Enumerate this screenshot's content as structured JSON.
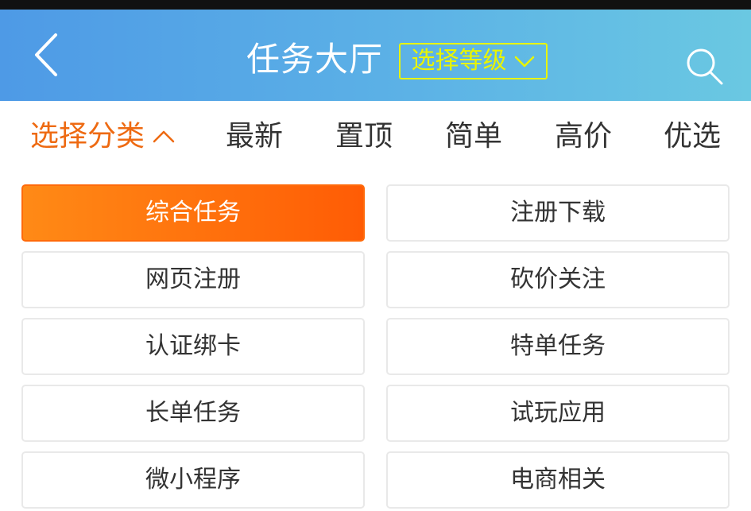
{
  "header": {
    "title": "任务大厅",
    "level_select_label": "选择等级",
    "back_icon": "chevron-left-icon",
    "search_icon": "search-icon"
  },
  "filters": {
    "category": "选择分类",
    "latest": "最新",
    "pinned": "置顶",
    "simple": "简单",
    "high_price": "高价",
    "preferred": "优选"
  },
  "categories": [
    "综合任务",
    "注册下载",
    "网页注册",
    "砍价关注",
    "认证绑卡",
    "特单任务",
    "长单任务",
    "试玩应用",
    "微小程序",
    "电商相关"
  ],
  "colors": {
    "header_start": "#4e9ae6",
    "header_end": "#6ac8e2",
    "level_accent": "#e9f500",
    "active_orange": "#ee6a12",
    "selected_start": "#ff8a16",
    "selected_end": "#ff5c05"
  }
}
